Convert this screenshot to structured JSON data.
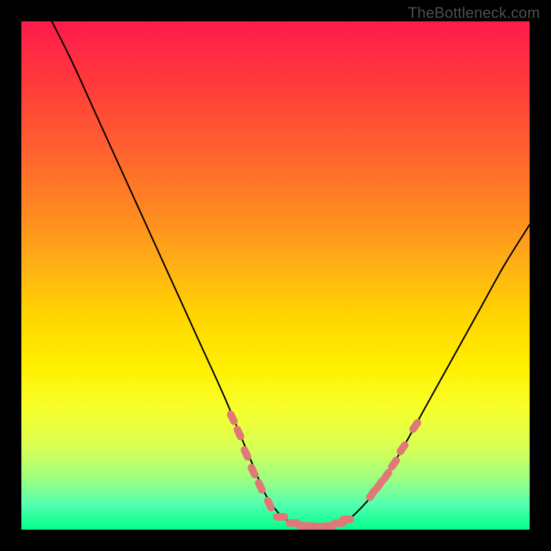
{
  "watermark": "TheBottleneck.com",
  "colors": {
    "frame": "#000000",
    "curve_stroke": "#000000",
    "marker_fill": "#e07878",
    "marker_stroke": "#c96060"
  },
  "chart_data": {
    "type": "line",
    "title": "",
    "xlabel": "",
    "ylabel": "",
    "xlim": [
      0,
      100
    ],
    "ylim": [
      0,
      100
    ],
    "grid": false,
    "legend": null,
    "series": [
      {
        "name": "curve",
        "x": [
          6,
          10,
          15,
          20,
          25,
          30,
          35,
          40,
          45,
          48,
          50,
          52,
          55,
          58,
          60,
          62,
          65,
          70,
          75,
          80,
          85,
          90,
          95,
          100
        ],
        "y": [
          100,
          92,
          81,
          70,
          59,
          48,
          37,
          26,
          14,
          7,
          4,
          2,
          1,
          0.5,
          0.5,
          1,
          2.5,
          8,
          16,
          25,
          34,
          43,
          52,
          60
        ]
      }
    ],
    "markers": [
      {
        "x": 41.5,
        "y": 22
      },
      {
        "x": 42.8,
        "y": 19
      },
      {
        "x": 44.2,
        "y": 15
      },
      {
        "x": 45.6,
        "y": 11.5
      },
      {
        "x": 47.0,
        "y": 8.5
      },
      {
        "x": 48.8,
        "y": 5
      },
      {
        "x": 51.0,
        "y": 2.5
      },
      {
        "x": 53.5,
        "y": 1.3
      },
      {
        "x": 55.5,
        "y": 0.8
      },
      {
        "x": 56.8,
        "y": 0.7
      },
      {
        "x": 58.5,
        "y": 0.6
      },
      {
        "x": 60.5,
        "y": 0.7
      },
      {
        "x": 62.5,
        "y": 1.3
      },
      {
        "x": 64.0,
        "y": 2.0
      },
      {
        "x": 69.0,
        "y": 7.0
      },
      {
        "x": 70.4,
        "y": 8.8
      },
      {
        "x": 71.8,
        "y": 10.6
      },
      {
        "x": 73.3,
        "y": 13.0
      },
      {
        "x": 75.0,
        "y": 16.0
      },
      {
        "x": 77.5,
        "y": 20.4
      }
    ]
  }
}
